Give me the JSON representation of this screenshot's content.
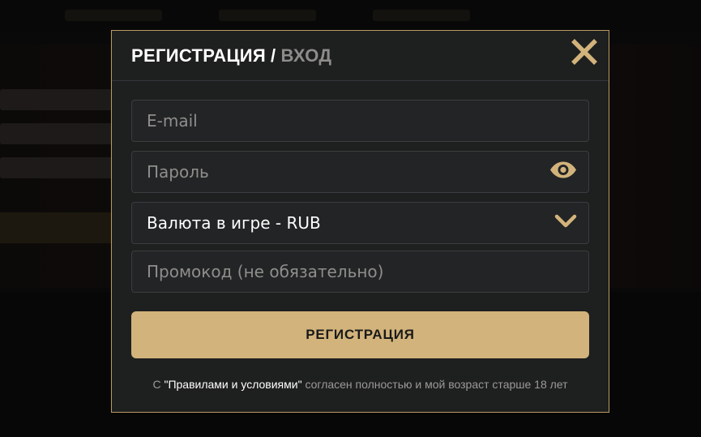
{
  "modal": {
    "title_register": "РЕГИСТРАЦИЯ",
    "title_separator": "/",
    "title_login": "ВХОД",
    "close_icon": "close-icon"
  },
  "form": {
    "email_placeholder": "E-mail",
    "password_placeholder": "Пароль",
    "password_toggle_icon": "eye-icon",
    "currency_value": "Валюта в игре - RUB",
    "currency_dropdown_icon": "chevron-down-icon",
    "promo_placeholder": "Промокод (не обязательно)",
    "submit_label": "РЕГИСТРАЦИЯ"
  },
  "terms": {
    "prefix": "С",
    "link": "\"Правилами и условиями\"",
    "suffix": "согласен полностью и мой возраст старше 18 лет"
  },
  "colors": {
    "accent": "#d2b37b",
    "modal_bg": "#1e1f1f",
    "border": "#b99b62"
  }
}
